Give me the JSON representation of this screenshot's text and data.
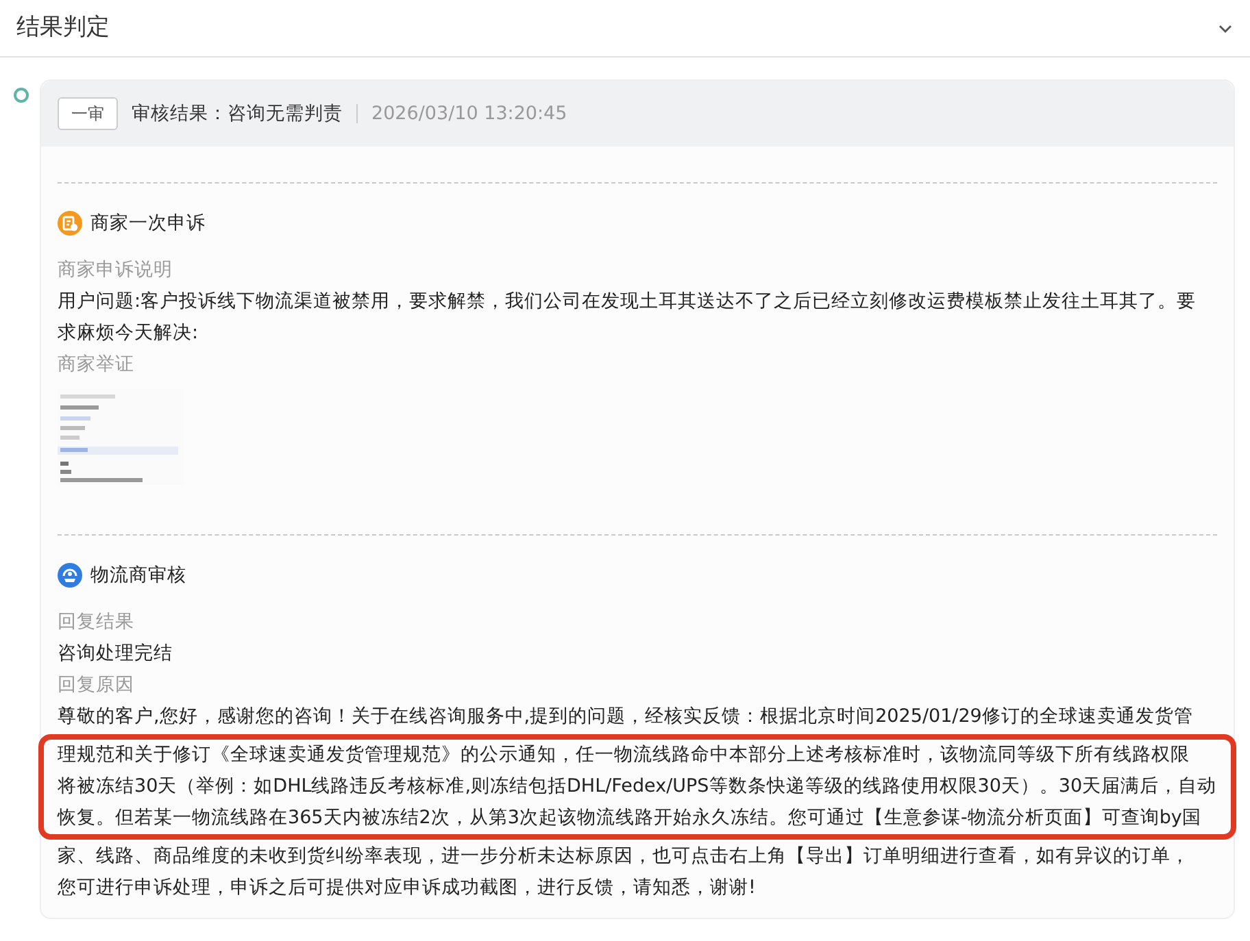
{
  "section": {
    "title": "结果判定",
    "expanded": true
  },
  "review": {
    "stage": "一审",
    "result": "审核结果：咨询无需判责",
    "time": "2026/03/10 13:20:45"
  },
  "blocks": [
    {
      "kind": "merchant",
      "title": "商家一次申诉",
      "fields": [
        {
          "kind": "label",
          "text": "商家申诉说明"
        },
        {
          "kind": "text",
          "lines": [
            {
              "kind": "plain",
              "text": "用户问题:客户投诉线下物流渠道被禁用，要求解禁，我们公司在发现土耳其送达不了之后已经立刻修改运费模板禁止发往土耳其了。要"
            },
            {
              "kind": "plain",
              "text": "求麻烦今天解决:"
            }
          ]
        },
        {
          "kind": "label",
          "text": "商家举证"
        },
        {
          "kind": "picture"
        }
      ]
    },
    {
      "kind": "logistics",
      "title": "物流商审核",
      "fields": [
        {
          "kind": "label",
          "text": "回复结果"
        },
        {
          "kind": "text",
          "lines": [
            {
              "kind": "plain",
              "text": "咨询处理完结"
            }
          ]
        },
        {
          "kind": "label",
          "text": "回复原因"
        },
        {
          "kind": "text",
          "lines": [
            {
              "kind": "plain",
              "text": "尊敬的客户,您好，感谢您的咨询！关于在线咨询服务中,提到的问题，经核实反馈：根据北京时间2025/01/29修订的全球速卖通发货管"
            },
            {
              "kind": "framed",
              "lines": [
                "理规范和关于修订《全球速卖通发货管理规范》的公示通知，任一物流线路命中本部分上述考核标准时，该物流同等级下所有线路权限",
                "将被冻结30天（举例：如DHL线路违反考核标准,则冻结包括DHL/Fedex/UPS等数条快递等级的线路使用权限30天）。30天届满后，自动",
                "恢复。但若某一物流线路在365天内被冻结2次，从第3次起该物流线路开始永久冻结。您可通过【生意参谋-物流分析页面】可查询by国"
              ]
            },
            {
              "kind": "plain",
              "text": "家、线路、商品维度的未收到货纠纷率表现，进一步分析未达标原因，也可点击右上角【导出】订单明细进行查看，如有异议的订单，"
            },
            {
              "kind": "plain",
              "text": "您可进行申诉处理，申诉之后可提供对应申诉成功截图，进行反馈，请知悉，谢谢!"
            }
          ]
        }
      ]
    }
  ]
}
